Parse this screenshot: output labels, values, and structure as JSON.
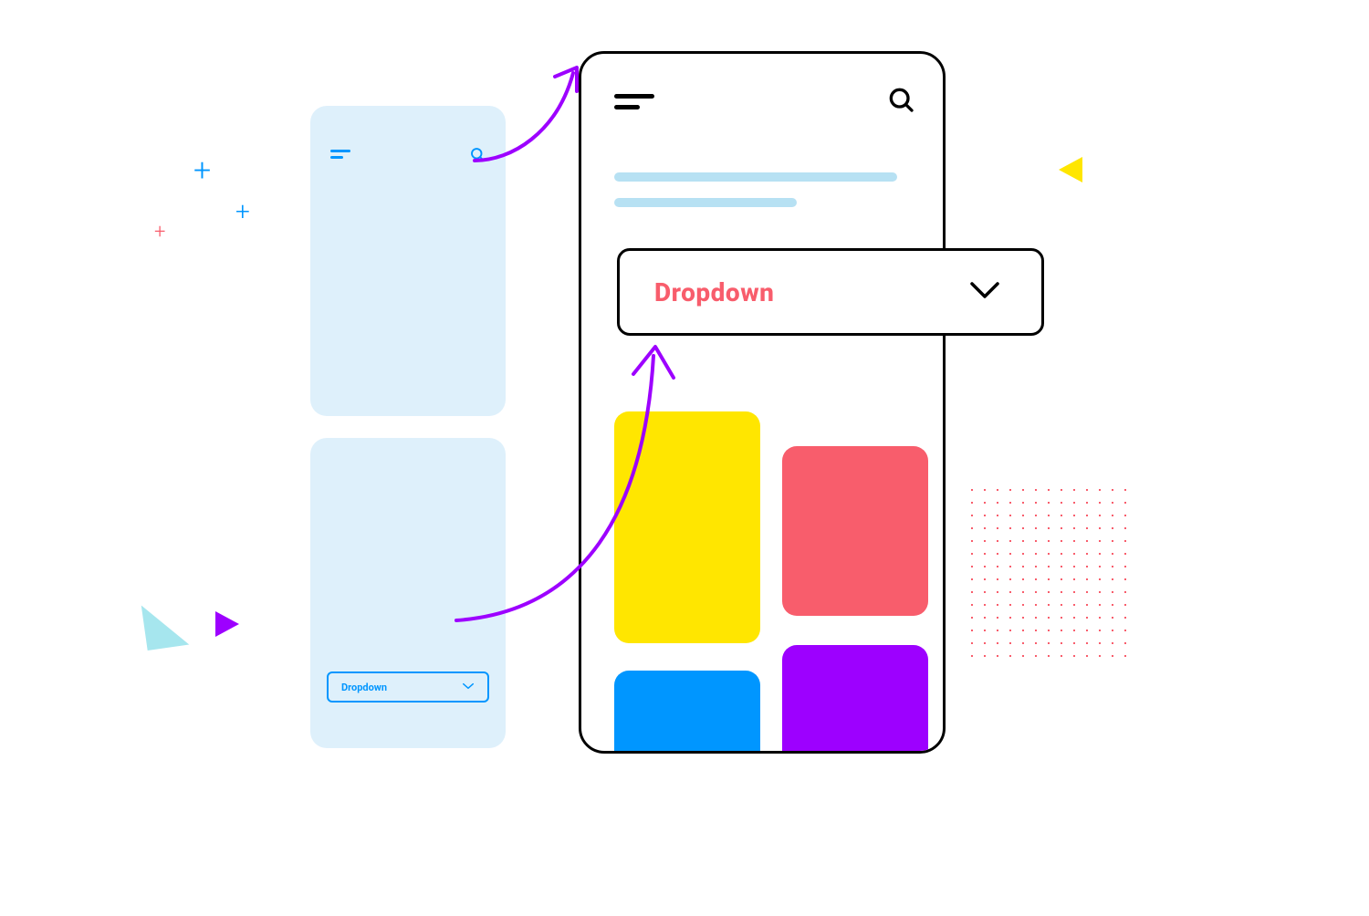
{
  "small_phone": {
    "dropdown_label": "Dropdown"
  },
  "large_phone": {
    "dropdown_label": "Dropdown"
  },
  "colors": {
    "accent_blue": "#0096ff",
    "accent_pink": "#f85d6c",
    "accent_yellow": "#ffe600",
    "accent_purple": "#9d00ff",
    "pale_blue": "#def0fb",
    "line_blue": "#b7e1f3"
  }
}
